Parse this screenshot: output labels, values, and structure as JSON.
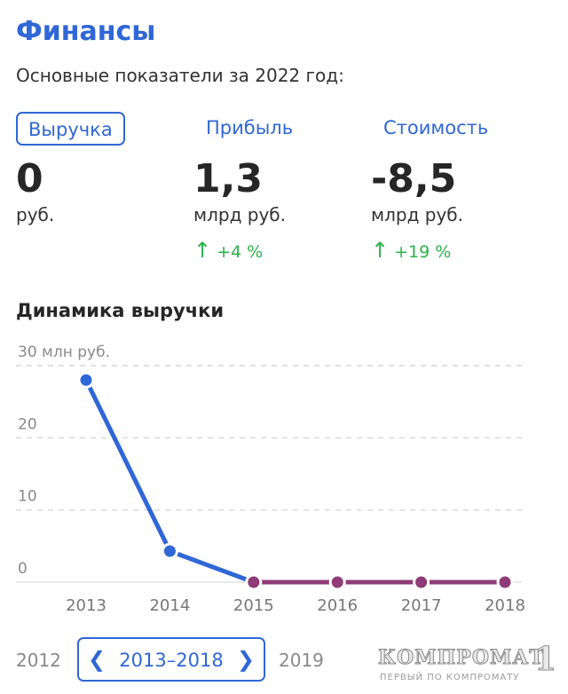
{
  "header": {
    "title": "Финансы",
    "subtitle": "Основные показатели за 2022 год:"
  },
  "metrics": [
    {
      "label": "Выручка",
      "value": "0",
      "unit": "руб.",
      "delta": "",
      "active": true
    },
    {
      "label": "Прибыль",
      "value": "1,3",
      "unit": "млрд руб.",
      "delta": "+4 %",
      "active": false
    },
    {
      "label": "Стоимость",
      "value": "-8,5",
      "unit": "млрд руб.",
      "delta": "+19 %",
      "active": false
    }
  ],
  "delta_arrow": "↑",
  "colors": {
    "accent": "#2f67d6",
    "positive": "#2bb34a",
    "zero_line": "#8e3b78"
  },
  "chart_title": "Динамика выручки",
  "chart_data": {
    "type": "line",
    "x": [
      "2013",
      "2014",
      "2015",
      "2016",
      "2017",
      "2018"
    ],
    "series": [
      {
        "values": [
          28,
          4.3,
          0,
          0,
          0,
          0
        ]
      }
    ],
    "yticks": [
      "30 млн руб.",
      "20",
      "10",
      "0"
    ],
    "ytick_values": [
      30,
      20,
      10,
      0
    ],
    "ylim": [
      0,
      30
    ],
    "grid": true,
    "legend": "none"
  },
  "period": {
    "prev": "2012",
    "range": "2013–2018",
    "next": "2019"
  },
  "watermark": {
    "main": "КОМПРОМАТ",
    "number": "1",
    "sub": "ПЕРВЫЙ ПО КОМПРОМАТУ"
  }
}
